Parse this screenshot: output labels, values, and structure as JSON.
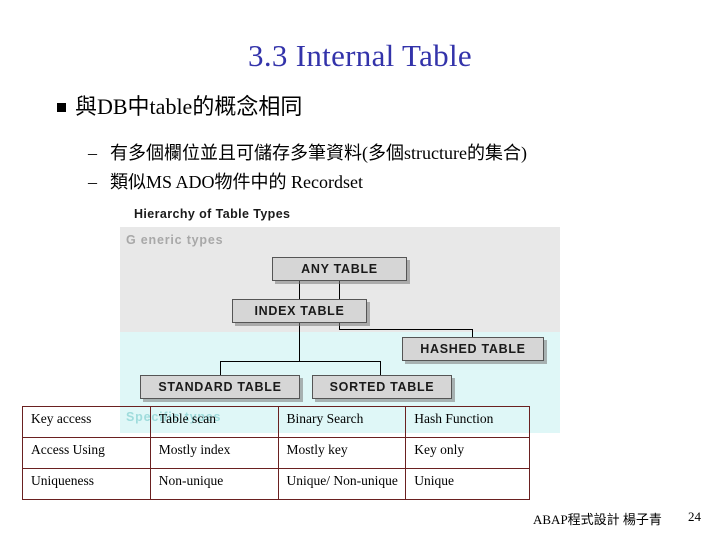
{
  "slide": {
    "title": "3.3 Internal Table",
    "bullets": [
      {
        "level": 1,
        "marker": "square",
        "text": "與DB中table的概念相同"
      },
      {
        "level": 2,
        "marker": "–",
        "text": "有多個欄位並且可儲存多筆資料(多個structure的集合)"
      },
      {
        "level": 2,
        "marker": "–",
        "text": "類似MS ADO物件中的 Recordset"
      }
    ]
  },
  "diagram": {
    "title": "Hierarchy of Table Types",
    "bands": [
      {
        "label": "G eneric types",
        "color": "#e8e8e8"
      },
      {
        "label": "Specific types",
        "color": "#dff7f7"
      }
    ],
    "nodes": [
      {
        "id": "any",
        "label": "ANY TABLE"
      },
      {
        "id": "index",
        "label": "INDEX TABLE"
      },
      {
        "id": "hashed",
        "label": "HASHED TABLE"
      },
      {
        "id": "standard",
        "label": "STANDARD TABLE"
      },
      {
        "id": "sorted",
        "label": "SORTED TABLE"
      }
    ]
  },
  "table": {
    "rows": [
      [
        "Key access",
        "Table scan",
        "Binary Search",
        "Hash Function"
      ],
      [
        "Access Using",
        "Mostly index",
        "Mostly key",
        "Key only"
      ],
      [
        "Uniqueness",
        "Non-unique",
        "Unique/ Non-unique",
        "Unique"
      ]
    ]
  },
  "footer": {
    "text": "ABAP程式設計 楊子青",
    "page": "24"
  }
}
